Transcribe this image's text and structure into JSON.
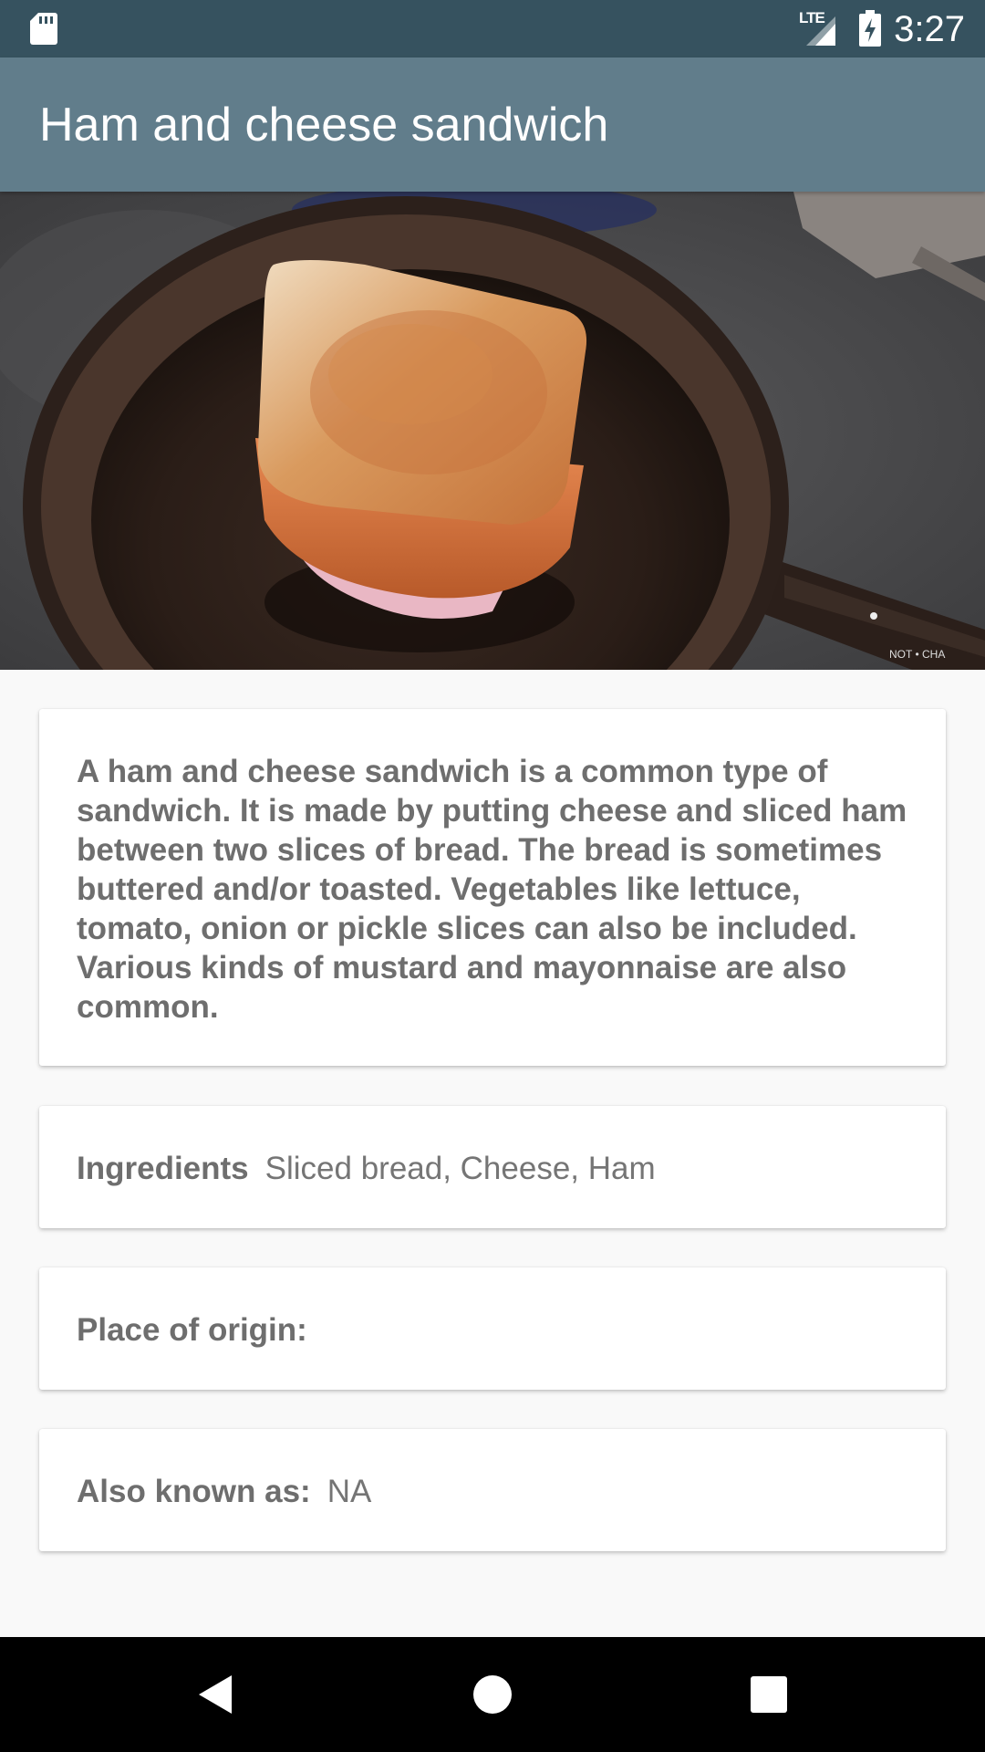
{
  "status_bar": {
    "network": "LTE",
    "time": "3:27",
    "icons": [
      "sd-card-icon",
      "signal-icon",
      "battery-charging-icon"
    ]
  },
  "app_bar": {
    "title": "Ham and cheese sandwich"
  },
  "hero_image": {
    "description_icon": "sandwich-photo",
    "watermark": "NOT • CHA"
  },
  "description": {
    "text": "A ham and cheese sandwich is a common type of sandwich. It is made by putting cheese and sliced ham between two slices of bread. The bread is sometimes buttered and/or toasted. Vegetables like lettuce, tomato, onion or pickle slices can also be included. Various kinds of mustard and mayonnaise are also common."
  },
  "details": {
    "ingredients": {
      "label": "Ingredients",
      "value": "Sliced bread, Cheese, Ham"
    },
    "origin": {
      "label": "Place of origin:",
      "value": ""
    },
    "aka": {
      "label": "Also known as:",
      "value": "NA"
    }
  },
  "nav_bar": {
    "icons": [
      "back-icon",
      "home-icon",
      "recents-icon"
    ]
  },
  "colors": {
    "status_bar": "#36525f",
    "app_bar": "#617d8b",
    "background": "#f9f9f9",
    "card": "#ffffff",
    "text": "#6e6e6e"
  }
}
